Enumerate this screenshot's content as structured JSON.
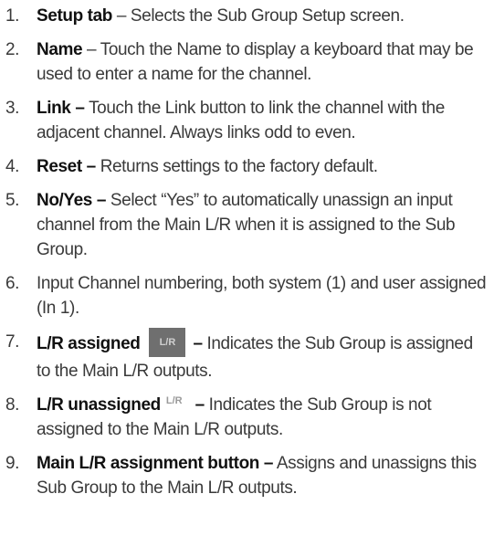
{
  "items": [
    {
      "num": "1.",
      "term": "Setup tab",
      "sep": " – ",
      "text": "Selects the Sub Group Setup screen."
    },
    {
      "num": "2.",
      "term": "Name",
      "sep": " – ",
      "text": "Touch the Name to display a keyboard that may be used to enter a name for the channel."
    },
    {
      "num": "3.",
      "term": "Link –",
      "sep": " ",
      "text": "Touch the Link button to link the channel with the adjacent channel. Always links odd to even."
    },
    {
      "num": "4.",
      "term": "Reset –",
      "sep": " ",
      "text": "Returns settings to the factory default."
    },
    {
      "num": "5.",
      "term": "No/Yes –",
      "sep": " ",
      "text": "Select “Yes” to automatically unassign an input channel from the Main L/R when it is assigned to the Sub Group."
    },
    {
      "num": "6.",
      "text": "Input Channel numbering, both system (1) and user assigned (In 1)."
    },
    {
      "num": "7.",
      "term": "L/R assigned",
      "badge": "L/R",
      "dash": "–",
      "text": " Indicates the Sub Group is assigned to the Main L/R outputs."
    },
    {
      "num": "8.",
      "term": "L/R unassigned",
      "badge": "L/R",
      "dash": "–",
      "text": " Indicates the Sub Group is not assigned to the Main L/R outputs."
    },
    {
      "num": "9.",
      "term": "Main L/R assignment button –",
      "sep": " ",
      "text": "Assigns and unassigns this Sub Group to the Main L/R outputs."
    }
  ]
}
